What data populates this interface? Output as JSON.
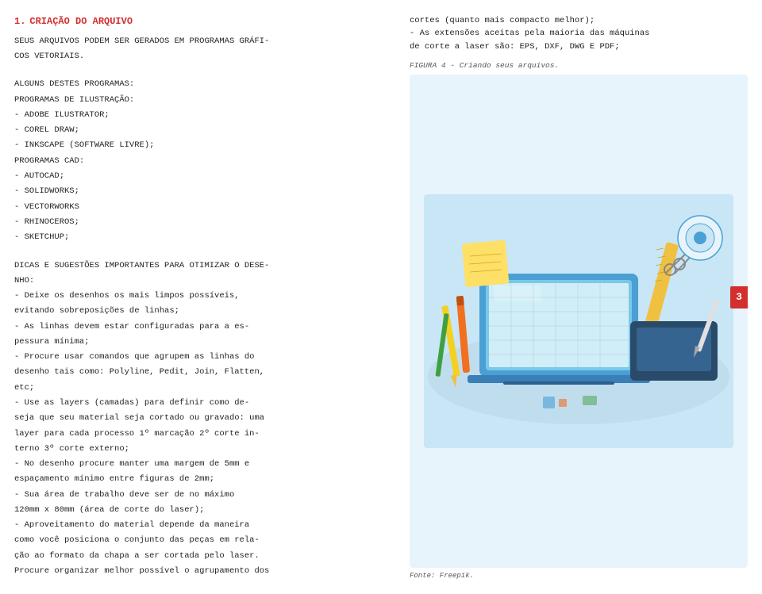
{
  "page": {
    "number": "3",
    "left": {
      "section_number": "1.",
      "section_title": "CRIAÇÃO DO ARQUIVO",
      "intro_line1": "SEUS ARQUIVOS PODEM SER GERADOS EM PROGRAMAS GRÁFI-",
      "intro_line2": "COS VETORIAIS.",
      "programs_intro": "ALGUNS DESTES PROGRAMAS:",
      "illu_header": "    PROGRAMAS DE ILUSTRAÇÃO:",
      "illu_items": [
        "-   ADOBE ILUSTRATOR;",
        "-   COREL DRAW;",
        "-   INKSCAPE (SOFTWARE LIVRE);"
      ],
      "cad_header": "    PROGRAMAS CAD:",
      "cad_items": [
        "-   AUTOCAD;",
        "-   SOLIDWORKS;",
        "-   VECTORWORKS",
        "-   RHINOCEROS;",
        "-   SKETCHUP;"
      ],
      "tips_header": "DICAS E SUGESTÕES IMPORTANTES PARA OTIMIZAR O DESE-",
      "tips_header2": "NHO:",
      "tips": [
        "-   Deixe os desenhos os mais limpos possíveis,",
        "evitando sobreposições de linhas;",
        "-   As linhas devem estar configuradas para a es-",
        "pessura mínima;",
        "-   Procure usar comandos que agrupem as linhas do",
        "desenho tais como: Polyline, Pedit, Join, Flatten,",
        "etc;",
        "-   Use as layers (camadas) para definir como de-",
        "seja que seu material seja cortado ou gravado: uma",
        "layer para cada processo 1º marcação 2º corte in-",
        "terno 3º corte externo;",
        "-   No desenho procure manter uma margem de 5mm e",
        "espaçamento mínimo entre figuras de 2mm;",
        "-   Sua área de trabalho deve ser de no máximo",
        "120mm x 80mm (área de corte do laser);",
        "-   Aproveitamento do material depende da maneira",
        "como você posiciona o conjunto das peças em rela-",
        "ção ao formato da chapa a ser cortada pelo laser.",
        "Procure organizar melhor possível o agrupamento dos"
      ]
    },
    "right": {
      "text_lines": [
        "cortes (quanto mais compacto melhor);",
        "-   As extensões aceitas pela maioria das máquinas",
        "de corte a laser são: EPS, DXF, DWG E PDF;"
      ],
      "figure_caption": "FIGURA 4 - Criando seus arquivos.",
      "figure_source": "Fonte: Freepik."
    }
  }
}
